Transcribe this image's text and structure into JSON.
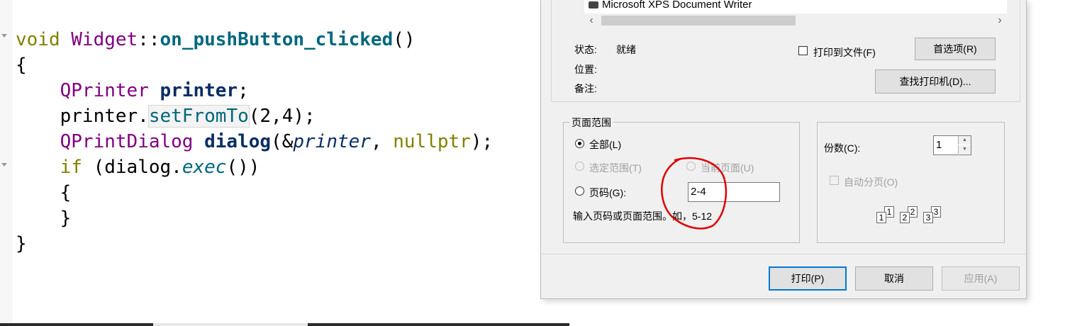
{
  "editor": {
    "lines": [
      {
        "tokens": [
          {
            "text": "void ",
            "cls": "kw"
          },
          {
            "text": "Widget",
            "cls": "ty"
          },
          {
            "text": "::",
            "cls": ""
          },
          {
            "text": "on_pushButton_clicked",
            "cls": "fn"
          },
          {
            "text": "()",
            "cls": ""
          }
        ]
      },
      {
        "tokens": [
          {
            "text": "{",
            "cls": ""
          }
        ]
      },
      {
        "tokens": [
          {
            "text": "    ",
            "cls": ""
          },
          {
            "text": "QPrinter",
            "cls": "ty"
          },
          {
            "text": " ",
            "cls": ""
          },
          {
            "text": "printer",
            "cls": "var"
          },
          {
            "text": ";",
            "cls": ""
          }
        ]
      },
      {
        "tokens": [
          {
            "text": "    printer.",
            "cls": ""
          },
          {
            "text": "setFromTo",
            "cls": "fnc-hl"
          },
          {
            "text": "(2,4);",
            "cls": ""
          }
        ]
      },
      {
        "tokens": [
          {
            "text": "    ",
            "cls": ""
          },
          {
            "text": "QPrintDialog",
            "cls": "ty"
          },
          {
            "text": " ",
            "cls": ""
          },
          {
            "text": "dialog",
            "cls": "var"
          },
          {
            "text": "(&",
            "cls": ""
          },
          {
            "text": "printer",
            "cls": "it"
          },
          {
            "text": ", ",
            "cls": ""
          },
          {
            "text": "nullptr",
            "cls": "kw"
          },
          {
            "text": ");",
            "cls": ""
          }
        ]
      },
      {
        "tokens": [
          {
            "text": "    ",
            "cls": ""
          },
          {
            "text": "if",
            "cls": "kw"
          },
          {
            "text": " (dialog.",
            "cls": ""
          },
          {
            "text": "exec",
            "cls": "itf"
          },
          {
            "text": "())",
            "cls": ""
          }
        ]
      },
      {
        "tokens": [
          {
            "text": "    {",
            "cls": ""
          }
        ]
      },
      {
        "tokens": [
          {
            "text": "    }",
            "cls": ""
          }
        ]
      },
      {
        "tokens": [
          {
            "text": "}",
            "cls": ""
          }
        ]
      }
    ]
  },
  "dialog": {
    "printer_list": {
      "item": "Microsoft XPS Document Writer",
      "icon": "printer-icon"
    },
    "status_label": "状态:",
    "status_value": "就绪",
    "location_label": "位置:",
    "comment_label": "备注:",
    "print_to_file": "打印到文件(F)",
    "preferences_button": "首选项(R)",
    "find_printer_button": "查找打印机(D)...",
    "page_range": {
      "title": "页面范围",
      "all": "全部(L)",
      "selection": "选定范围(T)",
      "current_page": "当前页面(U)",
      "pages": "页码(G):",
      "pages_value": "2-4",
      "hint": "输入页码或页面范围。如，5-12",
      "selected": "all"
    },
    "copies": {
      "label": "份数(C):",
      "value": "1",
      "collate": "自动分页(O)",
      "collate_icon": "collate-pages-icon",
      "collate_digits": [
        "1",
        "1",
        "2",
        "2",
        "3",
        "3"
      ]
    },
    "buttons": {
      "print": "打印(P)",
      "cancel": "取消",
      "apply": "应用(A)"
    },
    "annotation_color": "#e00000"
  }
}
